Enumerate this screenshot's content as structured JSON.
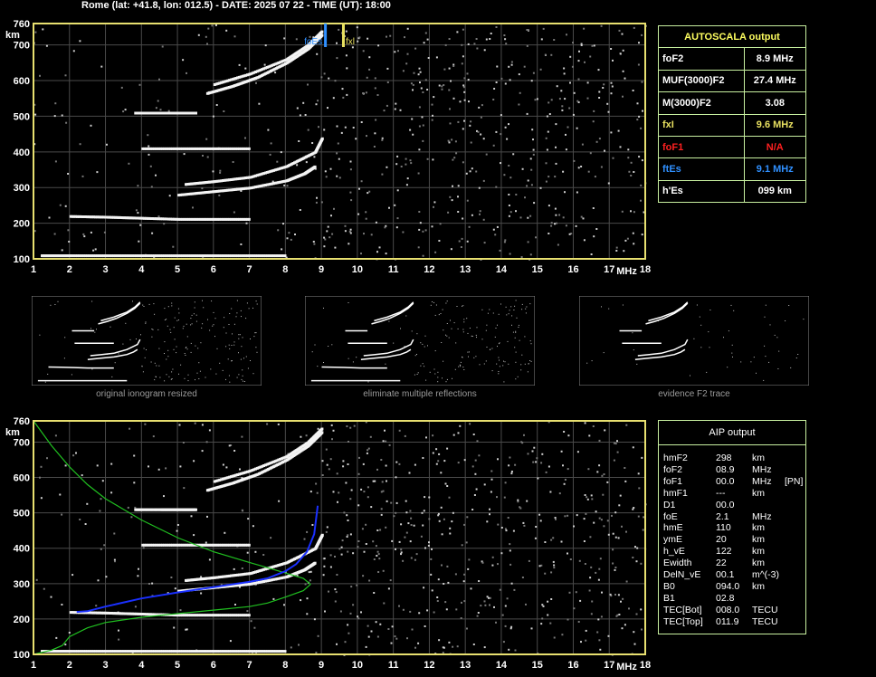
{
  "header": "Rome (lat: +41.8, lon: 012.5) - DATE: 2025 07 22 - TIME (UT): 18:00",
  "axis": {
    "y_unit": "km",
    "x_unit": "MHz",
    "y_ticks": [
      "100",
      "200",
      "300",
      "400",
      "500",
      "600",
      "700",
      "760"
    ],
    "x_ticks": [
      "1",
      "2",
      "3",
      "4",
      "5",
      "6",
      "7",
      "8",
      "9",
      "10",
      "11",
      "12",
      "13",
      "14",
      "15",
      "16",
      "17",
      "18"
    ]
  },
  "markers": {
    "foEs": "foEs",
    "fxl": "fxl"
  },
  "autoscala": {
    "title": "AUTOSCALA output",
    "rows": [
      {
        "label": "foF2",
        "value": "8.9 MHz",
        "color": "#ffffff"
      },
      {
        "label": "MUF(3000)F2",
        "value": "27.4 MHz",
        "color": "#ffffff"
      },
      {
        "label": "M(3000)F2",
        "value": "3.08",
        "color": "#ffffff"
      },
      {
        "label": "fxI",
        "value": "9.6 MHz",
        "color": "#e8e060"
      },
      {
        "label": "foF1",
        "value": "N/A",
        "color": "#ff2020"
      },
      {
        "label": "ftEs",
        "value": "9.1 MHz",
        "color": "#3090ff"
      },
      {
        "label": "h'Es",
        "value": "099    km",
        "color": "#ffffff"
      }
    ]
  },
  "thumbs": {
    "captions": [
      "original ionogram resized",
      "eliminate multiple reflections",
      "evidence F2 trace"
    ]
  },
  "aip": {
    "title": "AIP output",
    "rows": [
      {
        "k": "hmF2",
        "v": "298",
        "u": "km",
        "x": ""
      },
      {
        "k": "foF2",
        "v": "08.9",
        "u": "MHz",
        "x": ""
      },
      {
        "k": "foF1",
        "v": "00.0",
        "u": "MHz",
        "x": "[PN]"
      },
      {
        "k": "hmF1",
        "v": "---",
        "u": "km",
        "x": ""
      },
      {
        "k": "D1",
        "v": "00.0",
        "u": "",
        "x": ""
      },
      {
        "k": "foE",
        "v": "2.1",
        "u": "MHz",
        "x": ""
      },
      {
        "k": "hmE",
        "v": "110",
        "u": "km",
        "x": ""
      },
      {
        "k": "ymE",
        "v": "20",
        "u": "km",
        "x": ""
      },
      {
        "k": "h_vE",
        "v": "122",
        "u": "km",
        "x": ""
      },
      {
        "k": "Ewidth",
        "v": "22",
        "u": "km",
        "x": ""
      },
      {
        "k": "DelN_vE",
        "v": "00.1",
        "u": "m^(-3)",
        "x": ""
      },
      {
        "k": "B0",
        "v": "094.0",
        "u": "km",
        "x": ""
      },
      {
        "k": "B1",
        "v": "02.8",
        "u": "",
        "x": ""
      },
      {
        "k": "TEC[Bot]",
        "v": "008.0",
        "u": "TECU",
        "x": ""
      },
      {
        "k": "TEC[Top]",
        "v": "011.9",
        "u": "TECU",
        "x": ""
      }
    ]
  },
  "chart_data": [
    {
      "type": "scatter",
      "title": "",
      "xlabel": "MHz",
      "ylabel": "km",
      "xlim": [
        1,
        18
      ],
      "ylim": [
        100,
        760
      ],
      "grid": true,
      "series": [
        {
          "x": [
            1.2,
            2,
            3,
            4,
            5,
            6,
            7,
            8
          ],
          "y": [
            110,
            110,
            110,
            110,
            110,
            110,
            110,
            110
          ]
        },
        {
          "x": [
            2,
            3,
            4,
            5,
            6,
            7
          ],
          "y": [
            220,
            218,
            215,
            212,
            212,
            212
          ]
        },
        {
          "x": [
            5,
            6,
            7,
            8,
            8.5,
            8.8
          ],
          "y": [
            280,
            290,
            300,
            320,
            340,
            360
          ]
        },
        {
          "x": [
            5.2,
            6,
            7,
            8,
            8.8,
            9
          ],
          "y": [
            310,
            318,
            330,
            360,
            400,
            440
          ]
        },
        {
          "x": [
            4,
            5,
            6,
            7
          ],
          "y": [
            410,
            410,
            410,
            410
          ]
        },
        {
          "x": [
            3.8,
            4.5,
            5,
            5.5
          ],
          "y": [
            510,
            510,
            510,
            510
          ]
        },
        {
          "x": [
            5.8,
            6.5,
            7.2,
            8,
            8.6,
            9
          ],
          "y": [
            565,
            585,
            610,
            650,
            690,
            730
          ]
        },
        {
          "x": [
            6,
            7,
            8,
            8.6,
            9
          ],
          "y": [
            590,
            620,
            660,
            700,
            740
          ]
        }
      ]
    },
    {
      "type": "line",
      "title": "",
      "xlabel": "MHz",
      "ylabel": "km",
      "xlim": [
        1,
        18
      ],
      "ylim": [
        100,
        760
      ],
      "series": [
        {
          "x": [
            1,
            1.5,
            2,
            2.5,
            3,
            4,
            5,
            6,
            7,
            7.5,
            8,
            8.5,
            8.7
          ],
          "y": [
            760,
            690,
            630,
            580,
            540,
            480,
            430,
            390,
            360,
            345,
            330,
            315,
            298
          ]
        },
        {
          "x": [
            1,
            1.5,
            1.8,
            2,
            2.5,
            3,
            4,
            5,
            6,
            7,
            7.5,
            8,
            8.5,
            8.7
          ],
          "y": [
            100,
            112,
            125,
            150,
            175,
            190,
            205,
            215,
            225,
            235,
            245,
            262,
            280,
            298
          ]
        },
        {
          "x": [
            2.2,
            2.5,
            3,
            4,
            5,
            6,
            7,
            7.5,
            8,
            8.3,
            8.6,
            8.8,
            8.9
          ],
          "y": [
            220,
            222,
            235,
            258,
            275,
            290,
            305,
            315,
            335,
            355,
            390,
            440,
            520
          ]
        }
      ]
    }
  ],
  "colors": {
    "frame": "#e8e070",
    "grid": "#4a4a4a",
    "panel_border": "#c8f0a0",
    "green_curve": "#20c020",
    "blue_curve": "#1a30ff",
    "foEs_marker": "#3090ff",
    "fxl_marker": "#e8e060"
  }
}
